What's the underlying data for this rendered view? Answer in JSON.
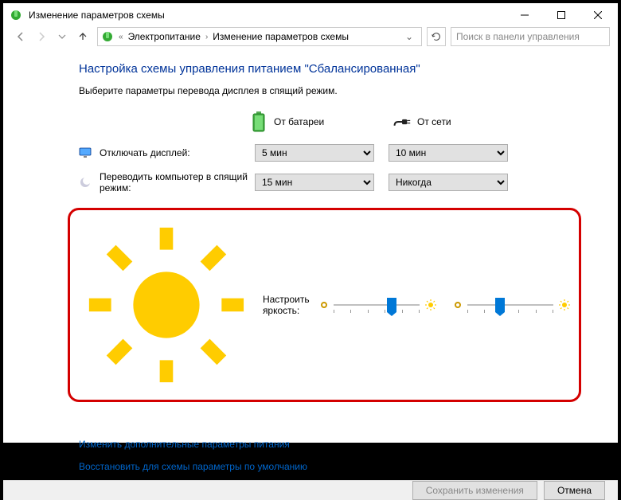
{
  "window": {
    "title": "Изменение параметров схемы"
  },
  "breadcrumb": {
    "root": "Электропитание",
    "current": "Изменение параметров схемы"
  },
  "search": {
    "placeholder": "Поиск в панели управления"
  },
  "heading": "Настройка схемы управления питанием \"Сбалансированная\"",
  "subheading": "Выберите параметры перевода дисплея в спящий режим.",
  "columns": {
    "battery": "От батареи",
    "plugged": "От сети"
  },
  "rows": {
    "display_off": {
      "label": "Отключать дисплей:",
      "battery": "5 мин",
      "plugged": "10 мин"
    },
    "sleep": {
      "label": "Переводить компьютер в спящий режим:",
      "battery": "15 мин",
      "plugged": "Никогда"
    },
    "brightness": {
      "label": "Настроить яркость:",
      "battery_pct": 68,
      "plugged_pct": 38
    }
  },
  "links": {
    "advanced": "Изменить дополнительные параметры питания",
    "restore": "Восстановить для схемы параметры по умолчанию"
  },
  "buttons": {
    "save": "Сохранить изменения",
    "cancel": "Отмена"
  }
}
